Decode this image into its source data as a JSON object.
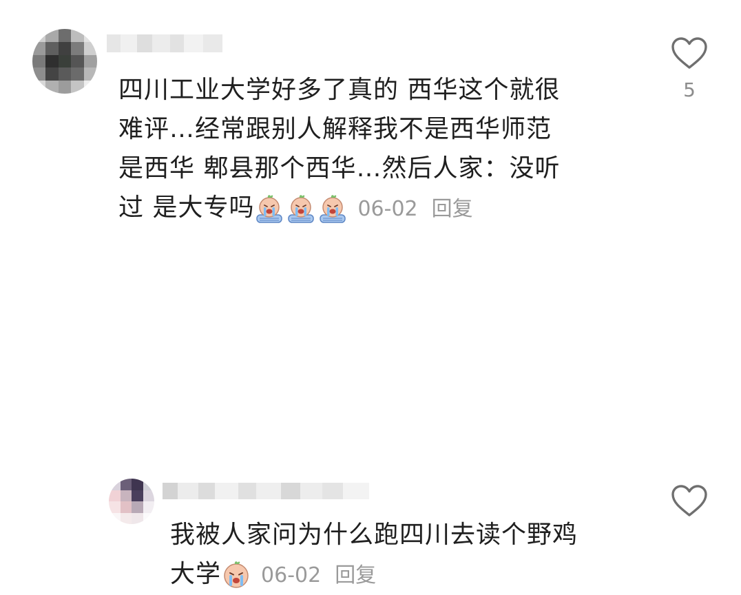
{
  "comments": [
    {
      "text_lines": [
        "四川工业大学好多了真的 西华这个就很",
        "难评…经常跟别人解释我不是西华师范",
        "是西华 郫县那个西华…然后人家：没听",
        "过 是大专吗"
      ],
      "emoji": [
        "crying-baby",
        "crying-baby",
        "crying-baby"
      ],
      "date": "06-02",
      "reply_label": "回复",
      "like_count": "5"
    },
    {
      "text_lines": [
        "我被人家问为什么跑四川去读个野鸡",
        "大学"
      ],
      "emoji": [
        "crying-baby"
      ],
      "date": "06-02",
      "reply_label": "回复",
      "like_count": ""
    }
  ],
  "colors": {
    "text": "#1f1f1f",
    "meta": "#9a9a9a",
    "heart_stroke": "#6f6f6f"
  }
}
